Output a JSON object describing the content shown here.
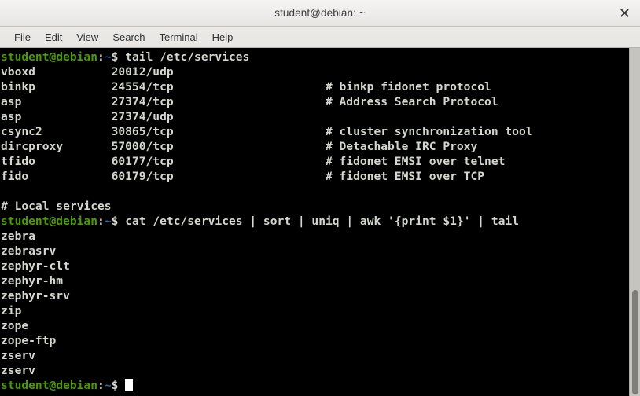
{
  "window": {
    "title": "student@debian: ~",
    "close_label": "×"
  },
  "menubar": {
    "items": [
      {
        "label": "File"
      },
      {
        "label": "Edit"
      },
      {
        "label": "View"
      },
      {
        "label": "Search"
      },
      {
        "label": "Terminal"
      },
      {
        "label": "Help"
      }
    ]
  },
  "terminal": {
    "prompt": {
      "user_host": "student@debian",
      "colon": ":",
      "path": "~",
      "sigil": "$ "
    },
    "command_1": "tail /etc/services",
    "command_2": "cat /etc/services | sort | uniq | awk '{print $1}' | tail",
    "services_output": [
      {
        "name": "vboxd",
        "port": "20012/udp",
        "comment": ""
      },
      {
        "name": "binkp",
        "port": "24554/tcp",
        "comment": "# binkp fidonet protocol"
      },
      {
        "name": "asp",
        "port": "27374/tcp",
        "comment": "# Address Search Protocol"
      },
      {
        "name": "asp",
        "port": "27374/udp",
        "comment": ""
      },
      {
        "name": "csync2",
        "port": "30865/tcp",
        "comment": "# cluster synchronization tool"
      },
      {
        "name": "dircproxy",
        "port": "57000/tcp",
        "comment": "# Detachable IRC Proxy"
      },
      {
        "name": "tfido",
        "port": "60177/tcp",
        "comment": "# fidonet EMSI over telnet"
      },
      {
        "name": "fido",
        "port": "60179/tcp",
        "comment": "# fidonet EMSI over TCP"
      }
    ],
    "local_services_header": "# Local services",
    "names_output": [
      "zebra",
      "zebrasrv",
      "zephyr-clt",
      "zephyr-hm",
      "zephyr-srv",
      "zip",
      "zope",
      "zope-ftp",
      "zserv",
      "zserv"
    ]
  },
  "scrollbar": {
    "thumb_top_percent": 69.5
  },
  "colors": {
    "terminal_bg": "#000000",
    "terminal_fg": "#d3d7cf",
    "prompt_green": "#4e9a06",
    "prompt_blue": "#3465a4",
    "chrome_bg": "#eceae7",
    "cursor": "#ffffff"
  }
}
